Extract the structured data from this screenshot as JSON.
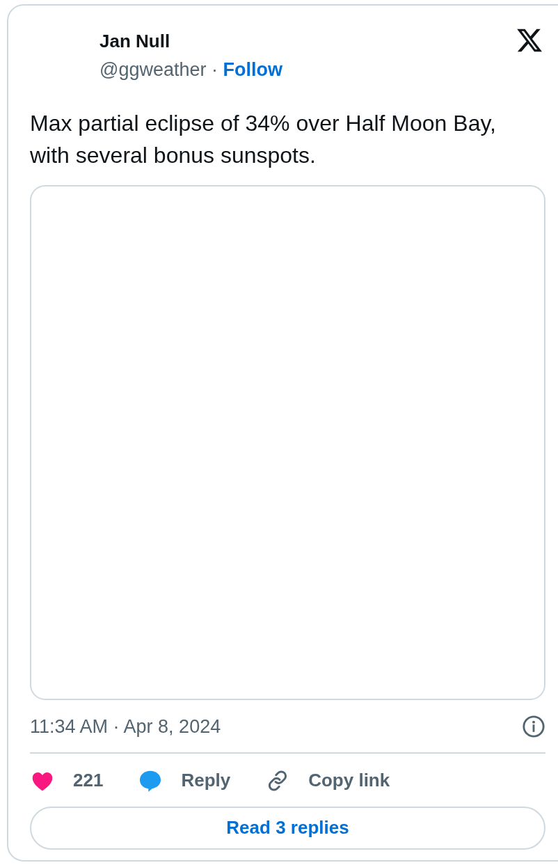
{
  "author": {
    "name": "Jan Null",
    "handle": "@ggweather",
    "separator": "·",
    "follow": "Follow"
  },
  "text": "Max partial eclipse of 34% over Half Moon Bay, with several bonus sunspots.",
  "timestamp": "11:34 AM · Apr 8, 2024",
  "actions": [
    {
      "kind": "like",
      "label": "221"
    },
    {
      "kind": "reply",
      "label": "Reply"
    },
    {
      "kind": "copy",
      "label": "Copy link"
    }
  ],
  "read_replies": "Read 3 replies"
}
